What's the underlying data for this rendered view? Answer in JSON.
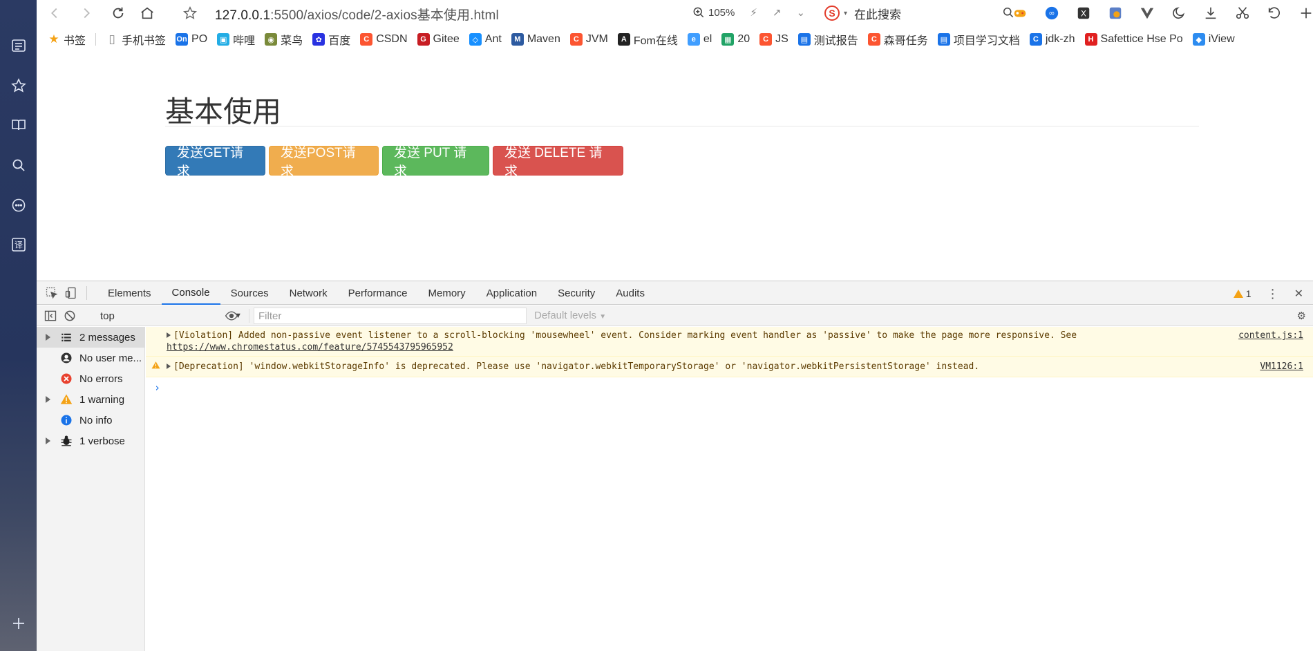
{
  "browser": {
    "url_host": "127.0.0.1",
    "url_path": ":5500/axios/code/2-axios基本使用.html",
    "zoom": "105%",
    "search_placeholder": "在此搜索"
  },
  "bookmarks": [
    {
      "label": "书签",
      "color": "#f4a215",
      "glyph": "★"
    },
    {
      "label": "手机书签",
      "color": "#888888",
      "glyph": "▯"
    },
    {
      "label": "PO",
      "color": "#1a73e8",
      "glyph": "On"
    },
    {
      "label": "哔哩",
      "color": "#23ade5",
      "glyph": "▣"
    },
    {
      "label": "菜鸟",
      "color": "#7a8a3a",
      "glyph": "◉"
    },
    {
      "label": "百度",
      "color": "#2932e1",
      "glyph": "✿"
    },
    {
      "label": "CSDN",
      "color": "#fc5531",
      "glyph": "C"
    },
    {
      "label": "Gitee",
      "color": "#c71d23",
      "glyph": "G"
    },
    {
      "label": "Ant",
      "color": "#1890ff",
      "glyph": "◇"
    },
    {
      "label": "Maven",
      "color": "#2d5aa0",
      "glyph": "M"
    },
    {
      "label": "JVM",
      "color": "#fc5531",
      "glyph": "C"
    },
    {
      "label": "Fom在线",
      "color": "#222222",
      "glyph": "A"
    },
    {
      "label": "el",
      "color": "#409eff",
      "glyph": "e"
    },
    {
      "label": "20",
      "color": "#21a366",
      "glyph": "▦"
    },
    {
      "label": "JS",
      "color": "#fc5531",
      "glyph": "C"
    },
    {
      "label": "测试报告",
      "color": "#1a73e8",
      "glyph": "▤"
    },
    {
      "label": "森哥任务",
      "color": "#fc5531",
      "glyph": "C"
    },
    {
      "label": "项目学习文档",
      "color": "#1a73e8",
      "glyph": "▤"
    },
    {
      "label": "jdk-zh",
      "color": "#1a73e8",
      "glyph": "C"
    },
    {
      "label": "Safettice Hse Po",
      "color": "#e02020",
      "glyph": "H"
    },
    {
      "label": "iView",
      "color": "#2d8cf0",
      "glyph": "◆"
    }
  ],
  "page": {
    "title": "基本使用",
    "buttons": {
      "get": "发送GET请求",
      "post": "发送POST请求",
      "put": "发送 PUT 请求",
      "delete": "发送 DELETE 请求"
    }
  },
  "devtools": {
    "tabs": [
      "Elements",
      "Console",
      "Sources",
      "Network",
      "Performance",
      "Memory",
      "Application",
      "Security",
      "Audits"
    ],
    "active_tab": "Console",
    "warning_count": "1",
    "context": "top",
    "filter_placeholder": "Filter",
    "levels": "Default levels",
    "sidebar": {
      "messages": "2 messages",
      "user": "No user me...",
      "errors": "No errors",
      "warnings": "1 warning",
      "info": "No info",
      "verbose": "1 verbose"
    },
    "messages": [
      {
        "text": "[Violation] Added non-passive event listener to a scroll-blocking 'mousewheel' event. Consider marking event handler as 'passive' to make the page more responsive. See ",
        "link": "https://www.chromestatus.com/feature/5745543795965952",
        "source": "content.js:1"
      },
      {
        "text": "[Deprecation] 'window.webkitStorageInfo' is deprecated. Please use 'navigator.webkitTemporaryStorage' or 'navigator.webkitPersistentStorage' instead.",
        "source": "VM1126:1"
      }
    ]
  },
  "colors": {
    "primary": "#337ab7",
    "warning": "#f0ad4e",
    "success": "#5cb85c",
    "danger": "#d9534f",
    "console_warn_bg": "#fffbe5"
  }
}
